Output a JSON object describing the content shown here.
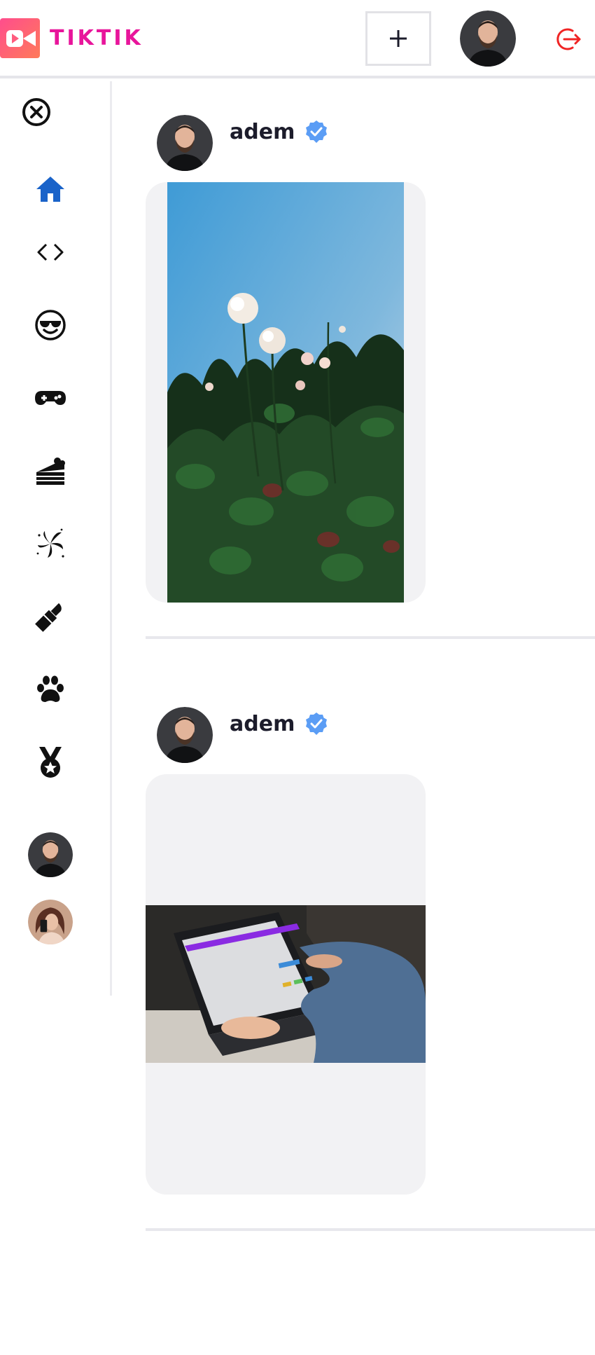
{
  "app": {
    "brand": "TIKTIK",
    "brand_color": "#e8159b",
    "accent_color": "#1a63c9",
    "logout_color": "#f02424",
    "verified_color": "#5b9df5"
  },
  "header": {
    "upload_icon": "plus-icon",
    "avatar_icon": "user-avatar",
    "logout_icon": "logout-icon"
  },
  "sidebar": {
    "close_icon": "close-circle-icon",
    "topics": [
      {
        "icon": "home-icon",
        "active": true
      },
      {
        "icon": "code-icon"
      },
      {
        "icon": "sunglasses-face-icon"
      },
      {
        "icon": "gamepad-icon"
      },
      {
        "icon": "cake-icon"
      },
      {
        "icon": "dance-icon"
      },
      {
        "icon": "lipstick-icon"
      },
      {
        "icon": "paw-icon"
      },
      {
        "icon": "medal-icon"
      }
    ],
    "accounts": [
      "adem-avatar",
      "woman-avatar"
    ]
  },
  "posts": [
    {
      "username": "adem",
      "verified": true,
      "media": "rose-bush-video"
    },
    {
      "username": "adem",
      "verified": true,
      "media": "laptop-video"
    }
  ]
}
